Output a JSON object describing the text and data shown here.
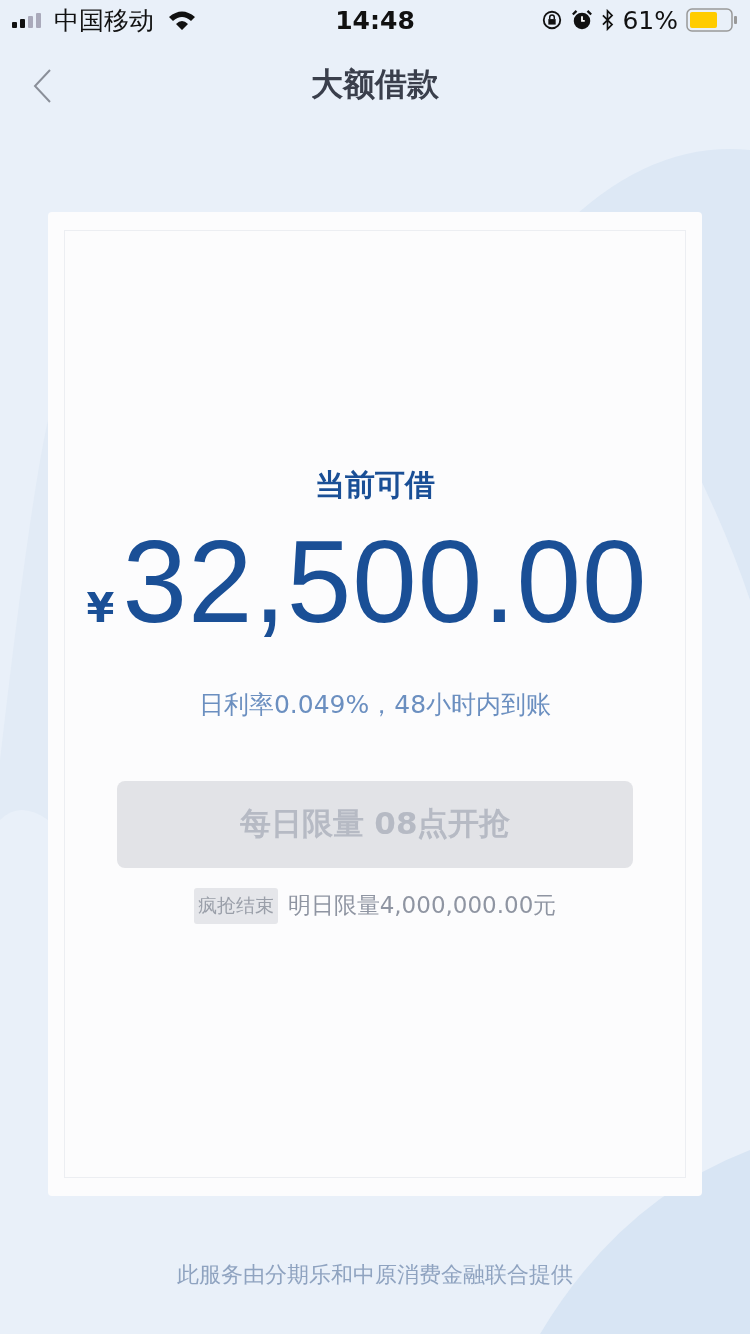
{
  "status_bar": {
    "carrier": "中国移动",
    "time": "14:48",
    "battery": "61%"
  },
  "nav": {
    "title": "大额借款"
  },
  "card": {
    "label": "当前可借",
    "currency": "¥",
    "amount": "32,500.00",
    "rate": "日利率0.049%，48小时内到账",
    "button": {
      "label": "每日限量 08点开抢",
      "disabled": true
    },
    "tag": "疯抢结束",
    "note": "明日限量4,000,000.00元"
  },
  "footer": "此服务由分期乐和中原消费金融联合提供"
}
